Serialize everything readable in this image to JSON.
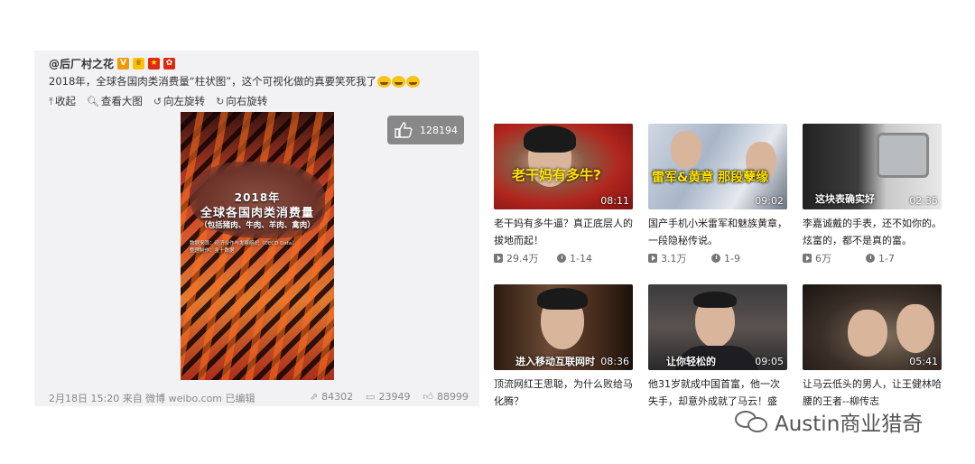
{
  "weibo": {
    "username": "@后厂村之花",
    "post_text": "2018年，全球各国肉类消费量“柱状图”，这个可视化做的真要笑死我了",
    "actions": [
      {
        "icon": "collapse-icon",
        "label": "收起"
      },
      {
        "icon": "search-icon",
        "label": "查看大图"
      },
      {
        "icon": "rotate-left-icon",
        "label": "向左旋转"
      },
      {
        "icon": "rotate-right-icon",
        "label": "向右旋转"
      }
    ],
    "image": {
      "line1": "2018年",
      "line2": "全球各国肉类消费量",
      "line3": "（包括猪肉、牛肉、羊肉、禽肉）",
      "line4": "数据来源：经济合作与发展组织（OECD Data）",
      "line5": "整理制作：金十数据"
    },
    "like_count": "128194",
    "meta": "2月18日 15:20 来自 微博 weibo.com   已编辑",
    "stats": {
      "forward": "84302",
      "comment": "23949",
      "like": "88999"
    }
  },
  "videos": [
    {
      "caption": "老干妈有多牛?",
      "duration": "08:11",
      "title": "老干妈有多牛逼？真正底层人的拔地而起！",
      "views": "29.4万",
      "episode": "1-14"
    },
    {
      "caption": "雷军&黄章 那段孽缘",
      "duration": "09:02",
      "title": "国产手机小米雷军和魅族黄章，一段隐秘传说。",
      "views": "3.1万",
      "episode": "1-9"
    },
    {
      "caption": "这块表确实好",
      "duration": "02:35",
      "title": "李嘉诚戴的手表，还不如你的。炫富的，都不是真的富。",
      "views": "6万",
      "episode": "1-7"
    },
    {
      "caption": "进入移动互联网时",
      "duration": "08:36",
      "title": "顶流网红王思聪，为什么败给马化腾？",
      "views": "",
      "episode": ""
    },
    {
      "caption": "让你轻松的",
      "duration": "09:05",
      "title": "他31岁就成中国首富，他一次失手，却意外成就了马云！盛",
      "views": "",
      "episode": ""
    },
    {
      "caption": "",
      "duration": "05:41",
      "title": "让马云低头的男人，让王健林哈腰的王者--柳传志",
      "views": "",
      "episode": ""
    }
  ],
  "watermark": "Austin商业猎奇"
}
